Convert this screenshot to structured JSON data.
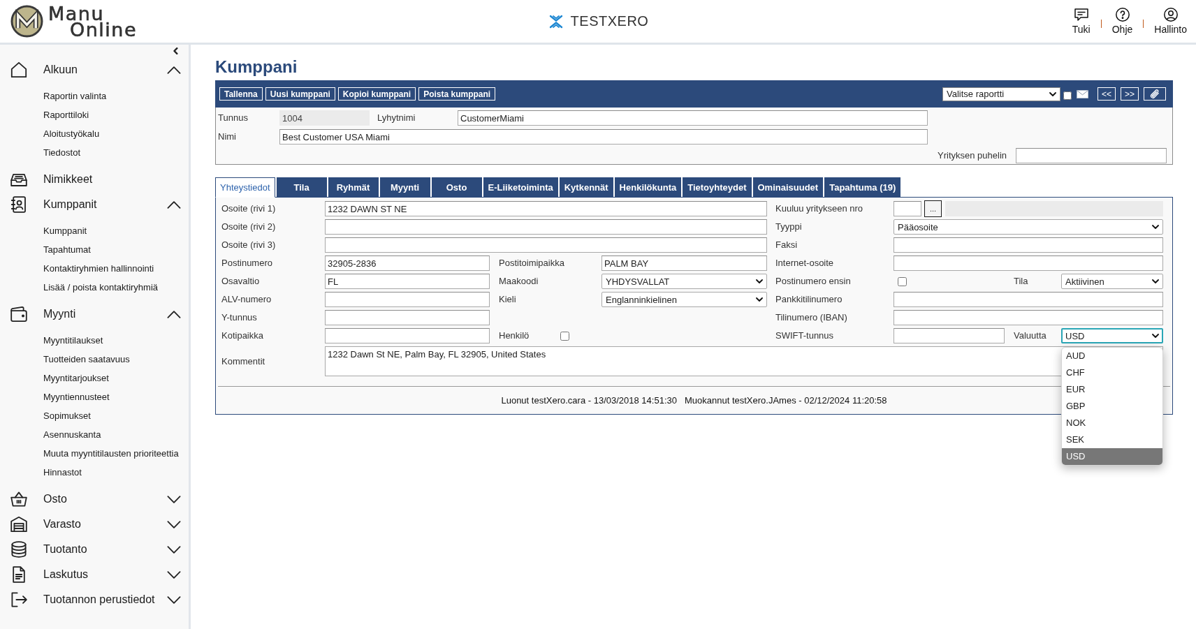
{
  "header": {
    "logo": {
      "line_1": "Manu",
      "line_2": "Online"
    },
    "tenant": "TESTXERO",
    "actions": [
      {
        "label": "Tuki"
      },
      {
        "label": "Ohje"
      },
      {
        "label": "Hallinto"
      }
    ]
  },
  "sidebar": {
    "items": [
      {
        "kind": "group",
        "label": "Alkuun",
        "expanded": true,
        "children": [
          {
            "label": "Raportin valinta"
          },
          {
            "label": "Raporttiloki"
          },
          {
            "label": "Aloitustyökalu"
          },
          {
            "label": "Tiedostot"
          }
        ]
      },
      {
        "kind": "link",
        "label": "Nimikkeet"
      },
      {
        "kind": "group",
        "label": "Kumppanit",
        "expanded": true,
        "children": [
          {
            "label": "Kumppanit"
          },
          {
            "label": "Tapahtumat"
          },
          {
            "label": "Kontaktiryhmien hallinnointi"
          },
          {
            "label": "Lisää / poista kontaktiryhmiä"
          }
        ]
      },
      {
        "kind": "group",
        "label": "Myynti",
        "expanded": true,
        "children": [
          {
            "label": "Myyntitilaukset"
          },
          {
            "label": "Tuotteiden saatavuus"
          },
          {
            "label": "Myyntitarjoukset"
          },
          {
            "label": "Myyntiennusteet"
          },
          {
            "label": "Sopimukset"
          },
          {
            "label": "Asennuskanta"
          },
          {
            "label": "Muuta myyntitilausten prioriteettia"
          },
          {
            "label": "Hinnastot"
          }
        ]
      },
      {
        "kind": "group",
        "label": "Osto",
        "expanded": false
      },
      {
        "kind": "group",
        "label": "Varasto",
        "expanded": false
      },
      {
        "kind": "group",
        "label": "Tuotanto",
        "expanded": false
      },
      {
        "kind": "group",
        "label": "Laskutus",
        "expanded": false
      },
      {
        "kind": "group",
        "label": "Tuotannon perustiedot",
        "expanded": false
      }
    ]
  },
  "page": {
    "title": "Kumppani"
  },
  "toolbar": {
    "buttons": [
      {
        "label": "Tallenna"
      },
      {
        "label": "Uusi kumppani"
      },
      {
        "label": "Kopioi kumppani"
      },
      {
        "label": "Poista kumppani"
      }
    ],
    "report_select": {
      "value": "Valitse raportti"
    },
    "email_checkbox": {
      "checked": false
    },
    "nav_buttons": [
      {
        "label": "<<"
      },
      {
        "label": ">>"
      }
    ]
  },
  "record": {
    "id": {
      "label": "Tunnus",
      "value": "1004",
      "readonly": true
    },
    "short_name": {
      "label": "Lyhytnimi",
      "value": "CustomerMiami"
    },
    "name": {
      "label": "Nimi",
      "value": "Best Customer USA Miami"
    },
    "phone": {
      "label": "Yrityksen puhelin"
    }
  },
  "tabs": [
    {
      "label": "Yhteystiedot",
      "selected": true
    },
    {
      "label": "Tila",
      "selected": false
    },
    {
      "label": "Ryhmät",
      "selected": false
    },
    {
      "label": "Myynti",
      "selected": false
    },
    {
      "label": "Osto",
      "selected": false
    },
    {
      "label": "E-Liiketoiminta",
      "selected": false
    },
    {
      "label": "Kytkennät",
      "selected": false
    },
    {
      "label": "Henkilökunta",
      "selected": false
    },
    {
      "label": "Tietoyhteydet",
      "selected": false
    },
    {
      "label": "Ominaisuudet",
      "selected": false
    },
    {
      "label": "Tapahtuma (19)",
      "selected": false
    }
  ],
  "contact_form": {
    "address_lines": [
      {
        "label": "Osoite (rivi 1)",
        "value": "1232 DAWN ST NE"
      },
      {
        "label": "Osoite (rivi 2)"
      },
      {
        "label": "Osoite (rivi 3)"
      }
    ],
    "details": [
      {
        "fields": [
          {
            "kind": "text",
            "label": "Postinumero",
            "value": "32905-2836"
          },
          {
            "kind": "text",
            "label": "Postitoimipaikka",
            "value": "PALM BAY"
          }
        ]
      },
      {
        "fields": [
          {
            "kind": "text",
            "label": "Osavaltio",
            "value": "FL"
          },
          {
            "kind": "select",
            "label": "Maakoodi",
            "value": "YHDYSVALLAT"
          }
        ]
      },
      {
        "fields": [
          {
            "kind": "text",
            "label": "ALV-numero"
          },
          {
            "kind": "select",
            "label": "Kieli",
            "value": "Englanninkielinen"
          }
        ]
      },
      {
        "fields": [
          {
            "kind": "text",
            "label": "Y-tunnus"
          }
        ]
      },
      {
        "fields": [
          {
            "kind": "text",
            "label": "Kotipaikka"
          },
          {
            "kind": "checkbox",
            "label": "Henkilö",
            "checked": false
          }
        ]
      }
    ],
    "side": [
      {
        "fields": [
          {
            "kind": "lookup",
            "label": "Kuuluu yritykseen nro",
            "button": "..."
          }
        ]
      },
      {
        "fields": [
          {
            "kind": "select",
            "label": "Tyyppi",
            "value": "Pääosoite"
          }
        ]
      },
      {
        "fields": [
          {
            "kind": "text",
            "label": "Faksi"
          }
        ]
      },
      {
        "fields": [
          {
            "kind": "text",
            "label": "Internet-osoite"
          }
        ]
      },
      {
        "fields": [
          {
            "kind": "checkbox",
            "label": "Postinumero ensin",
            "checked": false
          },
          {
            "kind": "select",
            "label": "Tila",
            "value": "Aktiivinen"
          }
        ]
      },
      {
        "fields": [
          {
            "kind": "text",
            "label": "Pankkitilinumero"
          }
        ]
      },
      {
        "fields": [
          {
            "kind": "text",
            "label": "Tilinumero (IBAN)"
          }
        ]
      },
      {
        "fields": [
          {
            "kind": "text",
            "label": "SWIFT-tunnus"
          },
          {
            "kind": "select",
            "label": "Valuutta",
            "value": "USD",
            "focused": true,
            "expanded": true,
            "options": [
              {
                "label": "AUD",
                "selected": false
              },
              {
                "label": "CHF",
                "selected": false
              },
              {
                "label": "EUR",
                "selected": false
              },
              {
                "label": "GBP",
                "selected": false
              },
              {
                "label": "NOK",
                "selected": false
              },
              {
                "label": "SEK",
                "selected": false
              },
              {
                "label": "USD",
                "selected": true
              }
            ]
          }
        ]
      }
    ],
    "comments": {
      "label": "Kommentit",
      "value": "1232 Dawn St NE, Palm Bay, FL 32905, United States"
    },
    "audit": {
      "created": "Luonut testXero.cara - 13/03/2018 14:51:30",
      "modified": "Muokannut testXero.JAmes - 02/12/2024 11:20:58"
    }
  }
}
